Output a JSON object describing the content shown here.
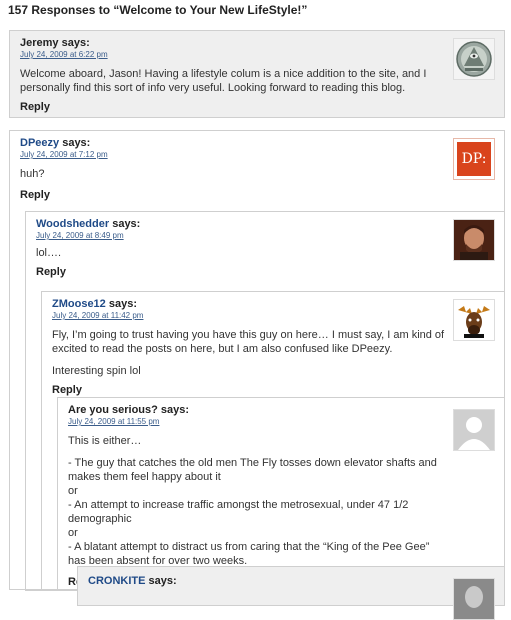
{
  "page_title": "157 Responses to “Welcome to Your New LifeStyle!”",
  "comments": [
    {
      "author": "Jeremy",
      "says": "says:",
      "date": "July 24, 2009 at 6:22 pm",
      "paragraphs": [
        "Welcome aboard, Jason! Having a lifestyle colum is a nice addition to the site, and I personally find this sort of info very useful. Looking forward to reading this blog."
      ],
      "reply": "Reply",
      "avatar": "eye-pyramid-avatar"
    },
    {
      "author": "DPeezy",
      "says": "says:",
      "date": "July 24, 2009 at 7:12 pm",
      "paragraphs": [
        "huh?"
      ],
      "reply": "Reply",
      "avatar": "dp-avatar",
      "avatar_text": "DP:"
    },
    {
      "author": "Woodshedder",
      "says": "says:",
      "date": "July 24, 2009 at 8:49 pm",
      "paragraphs": [
        "lol…."
      ],
      "reply": "Reply",
      "avatar": "man-portrait-avatar"
    },
    {
      "author": "ZMoose12",
      "says": "says:",
      "date": "July 24, 2009 at 11:42 pm",
      "paragraphs": [
        "Fly, I’m going to trust having you have this guy on here… I must say, I am kind of excited to read the posts on here, but I am also confused like DPeezy.",
        "Interesting spin lol"
      ],
      "reply": "Reply",
      "avatar": "moose-avatar"
    },
    {
      "author": "Are you serious?",
      "says": "says:",
      "date": "July 24, 2009 at 11:55 pm",
      "paragraphs": [
        "This is either…"
      ],
      "list_lines": [
        "- The guy that catches the old men The Fly tosses down elevator shafts and makes them feel happy about it",
        "or",
        "- An attempt to increase traffic amongst the metrosexual, under 47 1/2 demographic",
        "or",
        "- A blatant attempt to distract us from caring that the “King of the Pee Gee” has been absent for over two weeks."
      ],
      "reply": "Reply",
      "avatar": "default-person-avatar"
    },
    {
      "author": "CRONKITE",
      "says": "says:",
      "avatar": "cronkite-avatar"
    }
  ]
}
